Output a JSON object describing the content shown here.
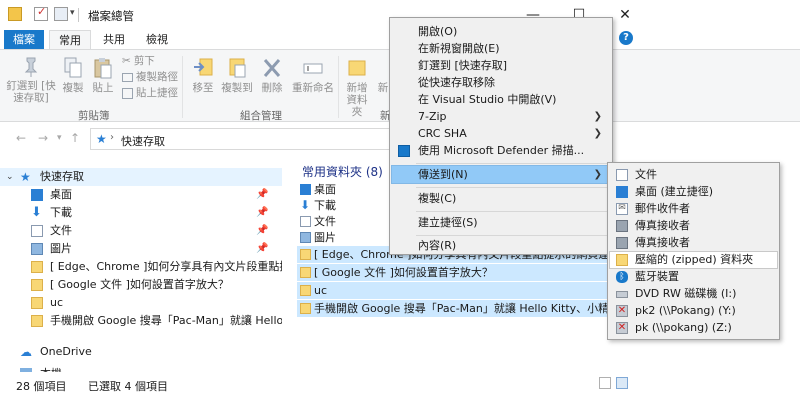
{
  "window": {
    "title": "檔案總管"
  },
  "tabs": {
    "file": "檔案",
    "home": "常用",
    "share": "共用",
    "view": "檢視"
  },
  "ribbon": {
    "pin": "釘選到 [快速存取]",
    "copy": "複製",
    "paste": "貼上",
    "cut": "剪下",
    "copy_path": "複製路徑",
    "paste_shortcut": "貼上捷徑",
    "move_to": "移至",
    "copy_to": "複製到",
    "delete": "刪除",
    "rename": "重新命名",
    "new_folder": "新增資料夾",
    "new_cut": "新",
    "group_clipboard": "剪貼簿",
    "group_organize": "組合管理",
    "group_new": "新"
  },
  "address": {
    "path": "快速存取"
  },
  "navpane": {
    "quick_access": "快速存取",
    "items": [
      {
        "label": "桌面",
        "pinned": true
      },
      {
        "label": "下載",
        "pinned": true
      },
      {
        "label": "文件",
        "pinned": true
      },
      {
        "label": "圖片",
        "pinned": true
      },
      {
        "label": "[ Edge、Chrome ]如何分享具有內文片段重點提示的網",
        "pinned": false
      },
      {
        "label": "[ Google 文件 ]如何設置首字放大？",
        "pinned": false
      },
      {
        "label": "uc",
        "pinned": false
      },
      {
        "label": "手機開啟 Google 搜尋「Pac-Man」就讓 Hello Kitty",
        "pinned": false
      }
    ],
    "onedrive": "OneDrive",
    "more": "本機"
  },
  "content": {
    "section_title": "常用資料夾 (8)",
    "items": [
      {
        "label": "桌面",
        "selected": false
      },
      {
        "label": "下載",
        "selected": false
      },
      {
        "label": "文件",
        "selected": false
      },
      {
        "label": "圖片",
        "selected": false
      },
      {
        "label": "[ Edge、Chrome ]如何分享具有內文片段重點提示的網頁連結？",
        "selected": true
      },
      {
        "label": "[ Google 文件 ]如何設置首字放大？",
        "selected": true
      },
      {
        "label": "uc",
        "selected": true
      },
      {
        "label": "手機開啟 Google 搜尋「Pac-Man」就讓 Hello Kitty、小精靈、布丁狗",
        "selected": true
      }
    ]
  },
  "status": {
    "count": "28 個項目",
    "selected": "已選取 4 個項目"
  },
  "context_menu": {
    "open": "開啟(O)",
    "open_new_window": "在新視窗開啟(E)",
    "pin_quick": "釘選到 [快速存取]",
    "unpin_quick": "從快速存取移除",
    "open_vs": "在 Visual Studio 中開啟(V)",
    "zip7": "7-Zip",
    "crc": "CRC SHA",
    "defender": "使用 Microsoft Defender 掃描...",
    "send_to": "傳送到(N)",
    "copy": "複製(C)",
    "shortcut": "建立捷徑(S)",
    "properties": "內容(R)"
  },
  "send_to_menu": [
    {
      "label": "文件",
      "icon": "document-icon"
    },
    {
      "label": "桌面 (建立捷徑)",
      "icon": "desktop-icon"
    },
    {
      "label": "郵件收件者",
      "icon": "mail-icon"
    },
    {
      "label": "傳真接收者",
      "icon": "fax-icon"
    },
    {
      "label": "傳真接收者",
      "icon": "fax-icon"
    },
    {
      "label": "壓縮的 (zipped) 資料夾",
      "icon": "zip-folder-icon"
    },
    {
      "label": "藍牙裝置",
      "icon": "bluetooth-icon"
    },
    {
      "label": "DVD RW 磁碟機 (I:)",
      "icon": "dvd-drive-icon"
    },
    {
      "label": "pk2 (\\\\Pokang) (Y:)",
      "icon": "network-drive-icon"
    },
    {
      "label": "pk (\\\\pokang) (Z:)",
      "icon": "network-drive-icon"
    }
  ],
  "colors": {
    "accent": "#1979ca",
    "selection": "#cce8ff",
    "menu_highlight": "#91c9f7"
  }
}
